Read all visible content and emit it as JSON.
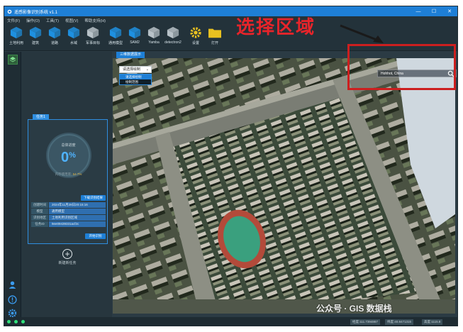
{
  "window": {
    "title": "遥感影像识别系统 v1.1",
    "controls": [
      "—",
      "☐",
      "✕"
    ]
  },
  "menu": [
    "文件(F)",
    "操作(O)",
    "工具(T)",
    "视图(V)",
    "帮助支持(H)"
  ],
  "toolbar": [
    {
      "label": "土地利用",
      "icon": "cube-icon",
      "color": "#1e90e0"
    },
    {
      "label": "建筑",
      "icon": "cube-icon",
      "color": "#1e90e0"
    },
    {
      "label": "道路",
      "icon": "cube-icon",
      "color": "#1e90e0"
    },
    {
      "label": "水域",
      "icon": "cube-icon",
      "color": "#1e90e0"
    },
    {
      "label": "军事目标",
      "icon": "cube-icon",
      "color": "#b8c2c8"
    },
    {
      "label": "通用模型",
      "icon": "cube-icon",
      "color": "#1e90e0"
    },
    {
      "label": "SAM2",
      "icon": "cube-icon",
      "color": "#1e90e0"
    },
    {
      "label": "Yamba",
      "icon": "cube-icon",
      "color": "#b8c2c8"
    },
    {
      "label": "detectron2",
      "icon": "cube-icon",
      "color": "#b8c2c8"
    },
    {
      "label": "设置",
      "icon": "gear-icon",
      "color": "#e8c020"
    },
    {
      "label": "打开",
      "icon": "folder-icon",
      "color": "#e8c020"
    }
  ],
  "task": {
    "tab_label": "任务1",
    "gauge_title": "总体进度",
    "progress_value": "0",
    "progress_unit": "%",
    "progress_fraction": 0,
    "memory_label": "内存使用率",
    "memory_value": "54.7%",
    "memory_fraction": 0.547,
    "download_button": "下载识别结果",
    "info": [
      {
        "key": "创建时间",
        "value": "2024年11月28日20:15:16"
      },
      {
        "key": "模型",
        "value": "通用模型"
      },
      {
        "key": "识别地区",
        "value": "土地利用识别区域"
      },
      {
        "key": "任务ID",
        "value": "9ee09439331acf2c"
      }
    ],
    "start_button": "开始识别"
  },
  "add_task_label": "新建新任务",
  "map": {
    "tab_label": "三维数据展示",
    "draw_mode_selected": "请选择绘制",
    "draw_mode_options": [
      "请选择绘制",
      "绘制范围"
    ],
    "search_value": "Hohhot, China"
  },
  "annotation": {
    "label": "选择区域"
  },
  "status": {
    "coords": [
      "经度:111.7394867",
      "纬度:40.8471315",
      "高度:1115.8"
    ]
  },
  "watermark": "公众号 · GIS 数据栈"
}
